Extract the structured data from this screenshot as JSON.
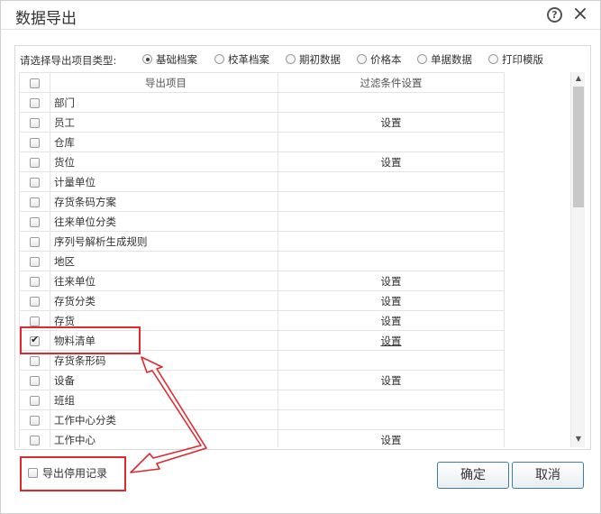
{
  "dialog": {
    "title": "数据导出",
    "help_label": "?",
    "close_label": "×"
  },
  "type_selector": {
    "prompt": "请选择导出项目类型:",
    "options": [
      {
        "label": "基础档案",
        "selected": true
      },
      {
        "label": "校革档案",
        "selected": false
      },
      {
        "label": "期初数据",
        "selected": false
      },
      {
        "label": "价格本",
        "selected": false
      },
      {
        "label": "单据数据",
        "selected": false
      },
      {
        "label": "打印模版",
        "selected": false
      }
    ]
  },
  "grid": {
    "columns": {
      "item": "导出项目",
      "filter": "过滤条件设置"
    },
    "rows": [
      {
        "name": "部门",
        "setting": "",
        "checked": false
      },
      {
        "name": "员工",
        "setting": "设置",
        "checked": false
      },
      {
        "name": "仓库",
        "setting": "",
        "checked": false
      },
      {
        "name": "货位",
        "setting": "设置",
        "checked": false
      },
      {
        "name": "计量单位",
        "setting": "",
        "checked": false
      },
      {
        "name": "存货条码方案",
        "setting": "",
        "checked": false
      },
      {
        "name": "往来单位分类",
        "setting": "",
        "checked": false
      },
      {
        "name": "序列号解析生成规则",
        "setting": "",
        "checked": false
      },
      {
        "name": "地区",
        "setting": "",
        "checked": false
      },
      {
        "name": "往来单位",
        "setting": "设置",
        "checked": false
      },
      {
        "name": "存货分类",
        "setting": "设置",
        "checked": false
      },
      {
        "name": "存货",
        "setting": "设置",
        "checked": false
      },
      {
        "name": "物料清单",
        "setting": "设置",
        "checked": true
      },
      {
        "name": "存货条形码",
        "setting": "",
        "checked": false
      },
      {
        "name": "设备",
        "setting": "设置",
        "checked": false
      },
      {
        "name": "班组",
        "setting": "",
        "checked": false
      },
      {
        "name": "工作中心分类",
        "setting": "",
        "checked": false
      },
      {
        "name": "工作中心",
        "setting": "设置",
        "checked": false
      }
    ]
  },
  "footer": {
    "export_disabled_label": "导出停用记录",
    "export_disabled_checked": false,
    "ok_label": "确定",
    "cancel_label": "取消"
  },
  "colors": {
    "highlight_red": "#e0282e",
    "button_border": "#3a7ca3"
  }
}
